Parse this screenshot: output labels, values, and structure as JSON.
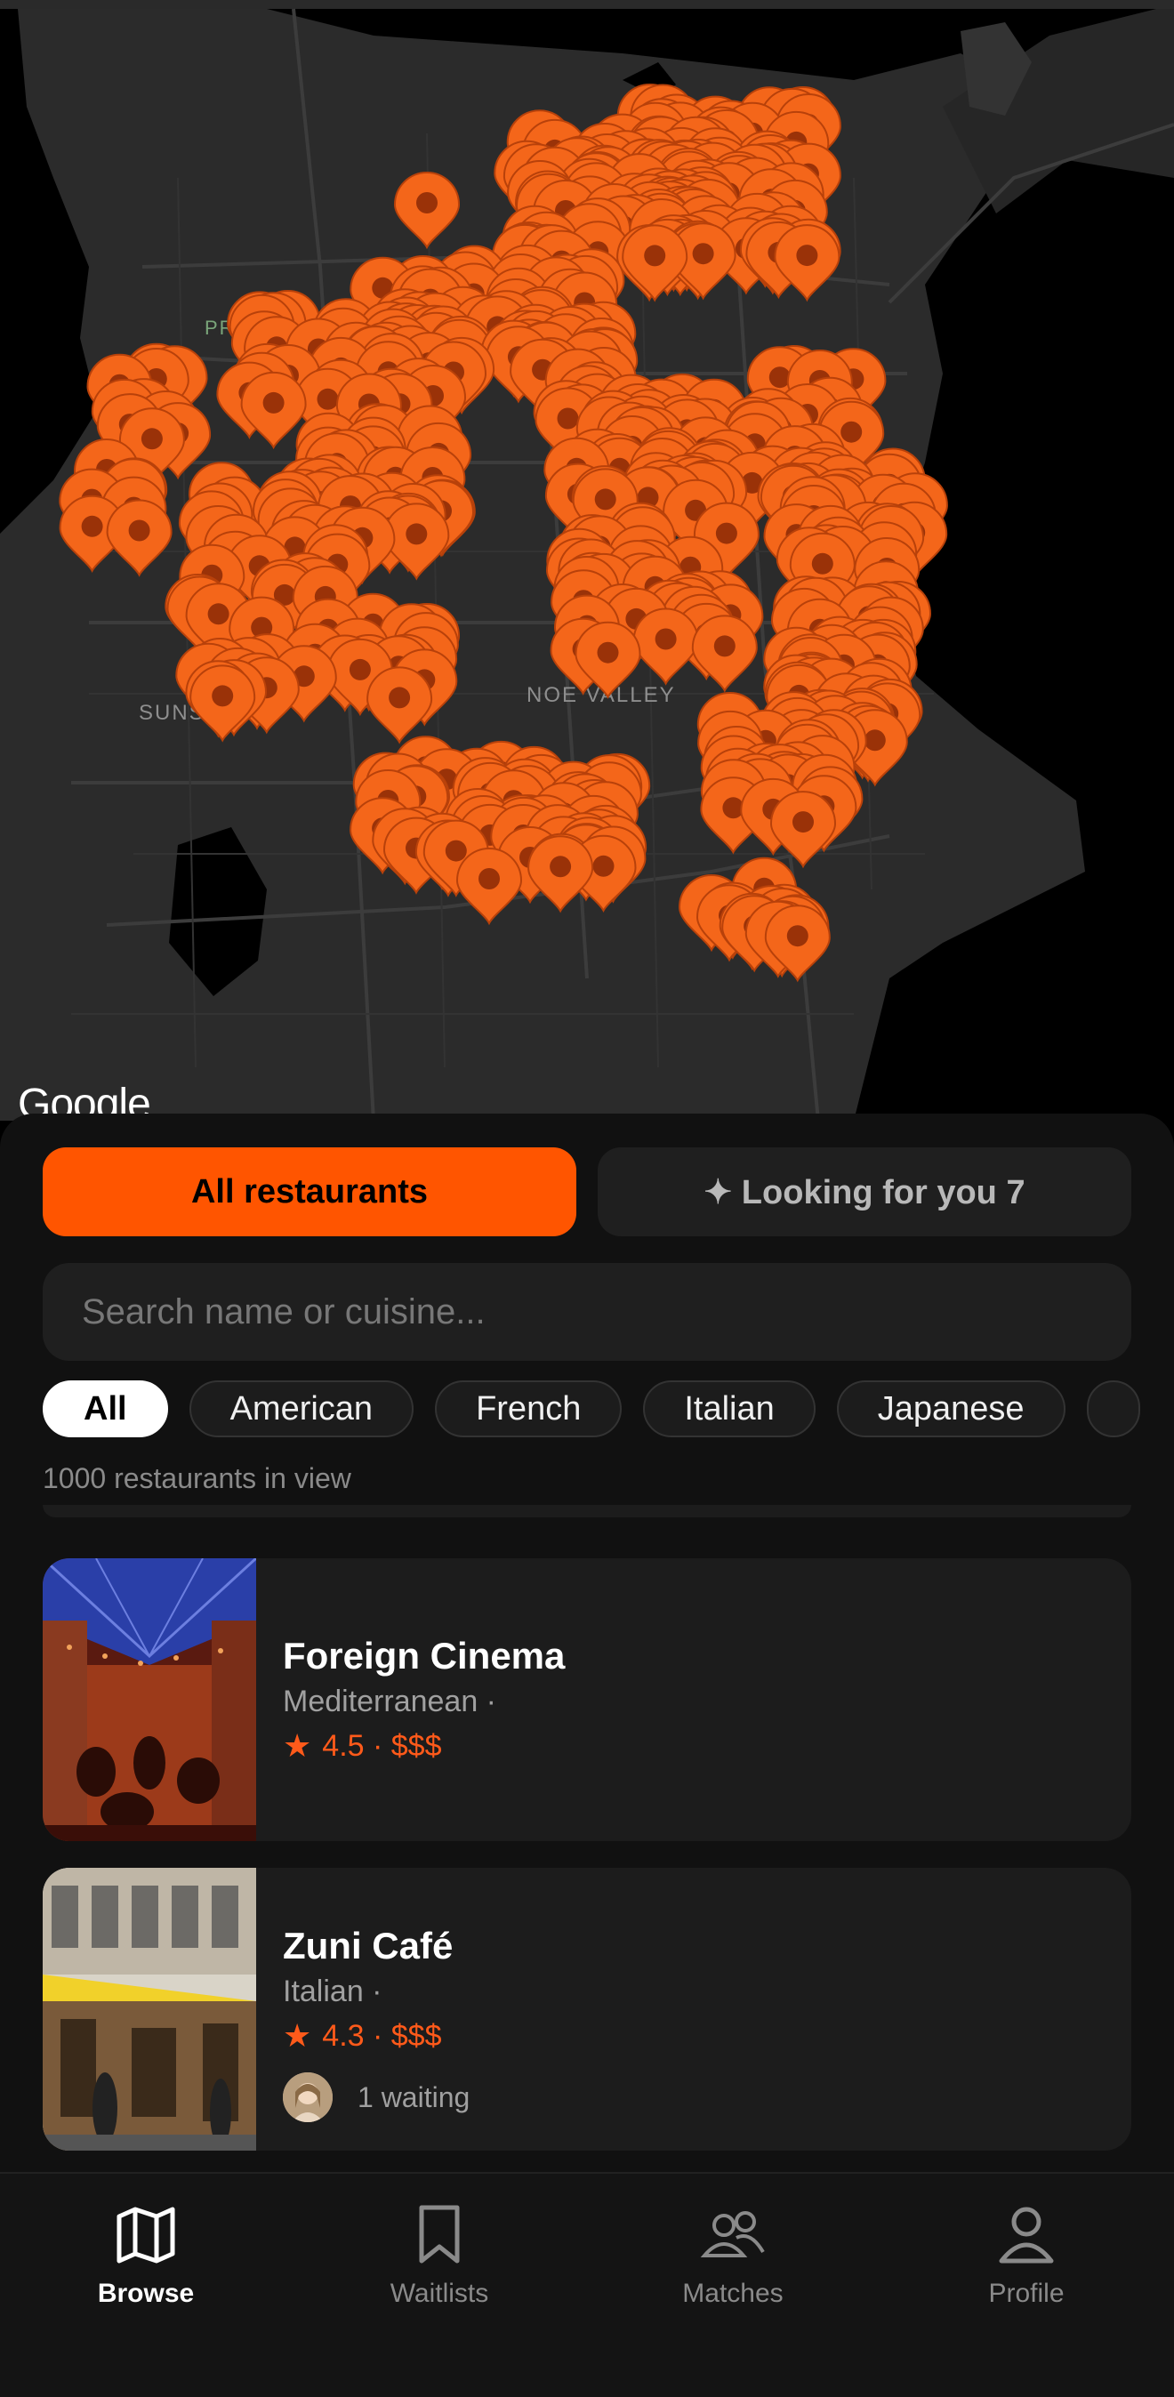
{
  "map": {
    "attribution": "Google",
    "labels": [
      "PRESIDIO",
      "SUNSET",
      "NOE VALLEY"
    ]
  },
  "toggle": {
    "all_label": "All restaurants",
    "looking_label": "✦ Looking for you 7"
  },
  "search": {
    "placeholder": "Search name or cuisine...",
    "value": ""
  },
  "filters": [
    "All",
    "American",
    "French",
    "Italian",
    "Japanese"
  ],
  "results": {
    "count_text": "1000 restaurants in view"
  },
  "restaurants": [
    {
      "name": "Foreign Cinema",
      "cuisine": "Mediterranean ·",
      "rating_text": "4.5 · $$$"
    },
    {
      "name": "Zuni Café",
      "cuisine": "Italian ·",
      "rating_text": "4.3 · $$$",
      "waiting_text": "1 waiting"
    }
  ],
  "tabs": [
    {
      "label": "Browse",
      "icon": "map-icon",
      "active": true
    },
    {
      "label": "Waitlists",
      "icon": "bookmark-icon",
      "active": false
    },
    {
      "label": "Matches",
      "icon": "people-icon",
      "active": false
    },
    {
      "label": "Profile",
      "icon": "person-icon",
      "active": false
    }
  ],
  "colors": {
    "accent": "#ff5500",
    "background": "#111111",
    "card": "#1c1c1c"
  }
}
